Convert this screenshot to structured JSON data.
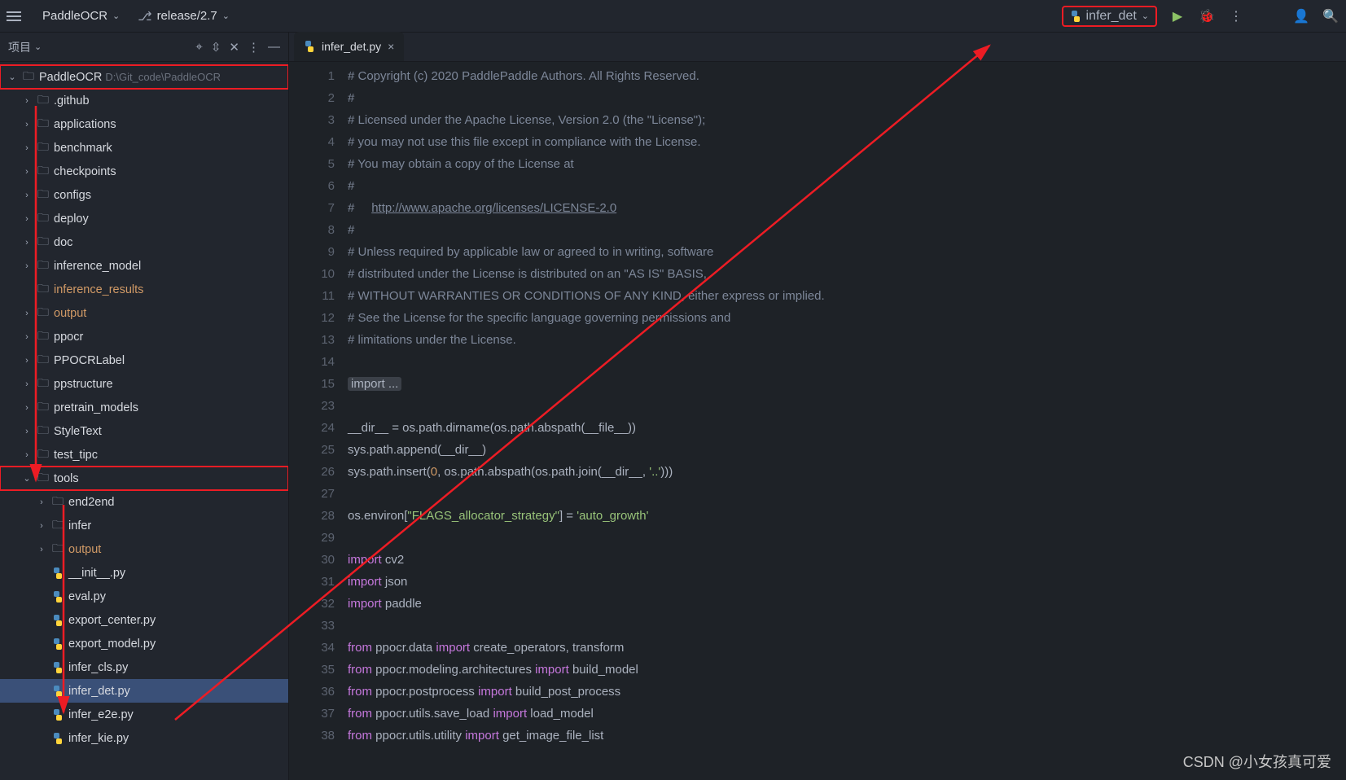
{
  "topbar": {
    "project": "PaddleOCR",
    "branch_icon": "⎇",
    "branch": "release/2.7",
    "runcfg": "infer_det",
    "icons": {
      "play": "▶",
      "bug": "🐞",
      "more": "⋮",
      "adduser": "👤+",
      "search": "🔍"
    }
  },
  "side": {
    "title": "项目",
    "hdr_icons": {
      "target": "⌖",
      "expand": "⇳",
      "close": "✕",
      "more": "⋮",
      "min": "—"
    }
  },
  "tree": {
    "root": "PaddleOCR",
    "rootpath": "D:\\Git_code\\PaddleOCR",
    "l1": [
      ".github",
      "applications",
      "benchmark",
      "checkpoints",
      "configs",
      "deploy",
      "doc",
      "inference_model",
      "inference_results",
      "output",
      "ppocr",
      "PPOCRLabel",
      "ppstructure",
      "pretrain_models",
      "StyleText",
      "test_tipc"
    ],
    "tools": "tools",
    "tools_sub": [
      "end2end",
      "infer",
      "output"
    ],
    "tools_files": [
      "__init__.py",
      "eval.py",
      "export_center.py",
      "export_model.py",
      "infer_cls.py",
      "infer_det.py",
      "infer_e2e.py",
      "infer_kie.py"
    ]
  },
  "tab": {
    "name": "infer_det.py",
    "close": "×"
  },
  "code": {
    "lines": [
      {
        "n": "1",
        "t": "cmt",
        "v": "# Copyright (c) 2020 PaddlePaddle Authors. All Rights Reserved."
      },
      {
        "n": "2",
        "t": "cmt",
        "v": "#"
      },
      {
        "n": "3",
        "t": "cmt",
        "v": "# Licensed under the Apache License, Version 2.0 (the \"License\");"
      },
      {
        "n": "4",
        "t": "cmt",
        "v": "# you may not use this file except in compliance with the License."
      },
      {
        "n": "5",
        "t": "cmt",
        "v": "# You may obtain a copy of the License at"
      },
      {
        "n": "6",
        "t": "cmt",
        "v": "#"
      },
      {
        "n": "7",
        "t": "link",
        "pfx": "#     ",
        "v": "http://www.apache.org/licenses/LICENSE-2.0"
      },
      {
        "n": "8",
        "t": "cmt",
        "v": "#"
      },
      {
        "n": "9",
        "t": "cmt",
        "v": "# Unless required by applicable law or agreed to in writing, software"
      },
      {
        "n": "10",
        "t": "cmt",
        "v": "# distributed under the License is distributed on an \"AS IS\" BASIS,"
      },
      {
        "n": "11",
        "t": "cmt",
        "v": "# WITHOUT WARRANTIES OR CONDITIONS OF ANY KIND, either express or implied."
      },
      {
        "n": "12",
        "t": "cmt",
        "v": "# See the License for the specific language governing permissions and"
      },
      {
        "n": "13",
        "t": "cmt",
        "v": "# limitations under the License."
      },
      {
        "n": "14",
        "t": "blank",
        "v": ""
      },
      {
        "n": "15",
        "t": "fold",
        "v": "import ..."
      },
      {
        "n": "23",
        "t": "blank",
        "v": ""
      },
      {
        "n": "24",
        "t": "code",
        "v": "__dir__ = os.path.dirname(os.path.abspath(__file__))"
      },
      {
        "n": "25",
        "t": "code",
        "v": "sys.path.append(__dir__)"
      },
      {
        "n": "26",
        "t": "insert",
        "a": "sys.path.insert(",
        "b": "0",
        "c": ", os.path.abspath(os.path.join(__dir__, ",
        "d": "'..'",
        "e": ")))"
      },
      {
        "n": "27",
        "t": "blank",
        "v": ""
      },
      {
        "n": "28",
        "t": "env",
        "a": "os.environ[",
        "b": "\"FLAGS_allocator_strategy\"",
        "c": "] = ",
        "d": "'auto_growth'"
      },
      {
        "n": "29",
        "t": "blank",
        "v": ""
      },
      {
        "n": "30",
        "t": "imp",
        "kw": "import",
        "m": "cv2"
      },
      {
        "n": "31",
        "t": "imp",
        "kw": "import",
        "m": "json"
      },
      {
        "n": "32",
        "t": "imp",
        "kw": "import",
        "m": "paddle"
      },
      {
        "n": "33",
        "t": "blank",
        "v": ""
      },
      {
        "n": "34",
        "t": "from",
        "a": "ppocr.data",
        "b": "create_operators, transform"
      },
      {
        "n": "35",
        "t": "from",
        "a": "ppocr.modeling.architectures",
        "b": "build_model"
      },
      {
        "n": "36",
        "t": "from",
        "a": "ppocr.postprocess",
        "b": "build_post_process"
      },
      {
        "n": "37",
        "t": "from",
        "a": "ppocr.utils.save_load",
        "b": "load_model"
      },
      {
        "n": "38",
        "t": "from",
        "a": "ppocr.utils.utility",
        "b": "get_image_file_list"
      }
    ]
  },
  "watermark": "CSDN @小女孩真可爱",
  "from_kw": "from",
  "import_kw": "import"
}
